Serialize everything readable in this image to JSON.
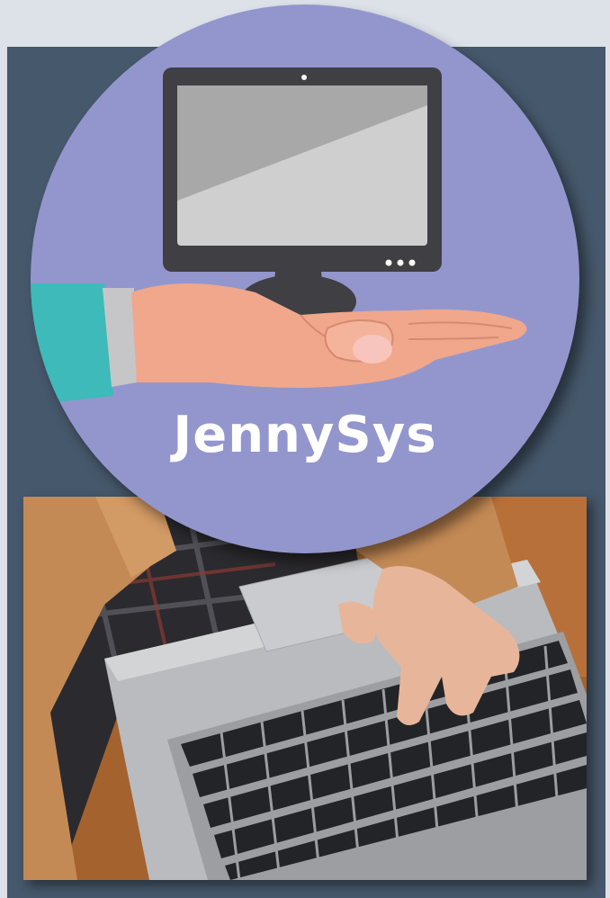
{
  "logo": {
    "brand_name": "JennySys",
    "badge_color": "#9396cd",
    "icon": "monitor-in-hand-icon"
  },
  "background": {
    "panel_color": "#46586b",
    "page_color": "#dde1e8"
  },
  "photo": {
    "subject": "hands-typing-on-laptop-photo"
  }
}
